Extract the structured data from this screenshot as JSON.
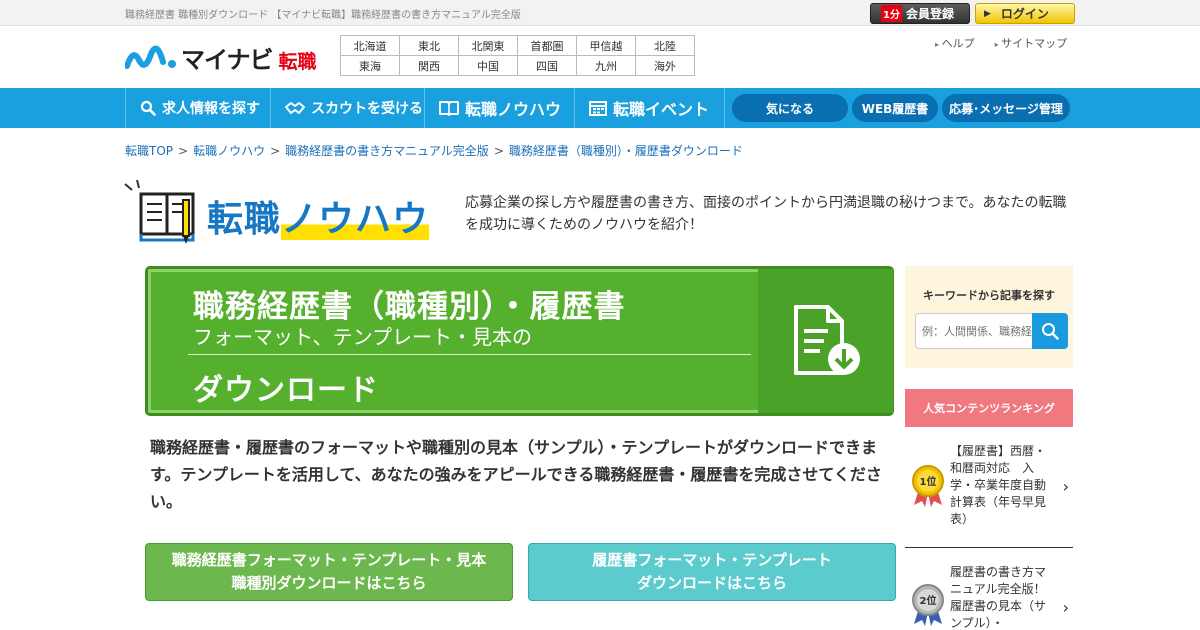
{
  "page_title": "職務経歴書 職種別ダウンロード 【マイナビ転職】職務経歴書の書き方マニュアル完全版",
  "top_buttons": {
    "register_badge": "1分",
    "register": "会員登録",
    "login": "ログイン"
  },
  "logo": {
    "main": "マイナビ",
    "sub": "転職"
  },
  "areas": [
    [
      "北海道",
      "東北",
      "北関東",
      "首都圏",
      "甲信越",
      "北陸"
    ],
    [
      "東海",
      "関西",
      "中国",
      "四国",
      "九州",
      "海外"
    ]
  ],
  "help_links": [
    "ヘルプ",
    "サイトマップ"
  ],
  "nav": {
    "items": [
      "求人情報を探す",
      "スカウトを受ける",
      "転職ノウハウ",
      "転職イベント"
    ],
    "pills": [
      "気になる",
      "WEB履歴書",
      "応募･メッセージ管理"
    ]
  },
  "breadcrumb": [
    "転職TOP",
    "転職ノウハウ",
    "職務経歴書の書き方マニュアル完全版",
    "職務経歴書（職種別）・履歴書ダウンロード"
  ],
  "breadcrumb_sep": ">",
  "section": {
    "title_a": "転職",
    "title_b": "ノウハウ",
    "description": "応募企業の探し方や履歴書の書き方、面接のポイントから円満退職の秘けつまで。あなたの転職を成功に導くためのノウハウを紹介！"
  },
  "banner": {
    "line1": "職務経歴書（職種別）・履歴書",
    "line2": "フォーマット、テンプレート・見本の",
    "line3": "ダウンロード",
    "icon": "document-download-icon"
  },
  "intro": "職務経歴書・履歴書のフォーマットや職種別の見本（サンプル）・テンプレートがダウンロードできます。テンプレートを活用して、あなたの強みをアピールできる職務経歴書・履歴書を完成させてください。",
  "action_buttons": [
    {
      "line1": "職務経歴書フォーマット・テンプレート・見本",
      "line2": "職種別ダウンロードはこちら"
    },
    {
      "line1": "履歴書フォーマット・テンプレート",
      "line2": "ダウンロードはこちら"
    }
  ],
  "sidebar": {
    "search_heading": "キーワードから記事を探す",
    "search_placeholder": "例：人間関係、職務経歴書",
    "ranking_heading": "人気コンテンツランキング",
    "ranking": [
      {
        "rank": "1位",
        "title": "【履歴書】西暦・和暦両対応　入学・卒業年度自動計算表（年号早見表）"
      },
      {
        "rank": "2位",
        "title": "履歴書の書き方マニュアル完全版！　履歴書の見本（サンプル）・"
      }
    ]
  },
  "colors": {
    "nav_blue": "#1aa0de",
    "pill_blue": "#0a6fb0",
    "banner_green": "#55b02e",
    "ranking_pink": "#f0787e",
    "brand_red": "#e60012",
    "title_blue": "#1677c4"
  }
}
